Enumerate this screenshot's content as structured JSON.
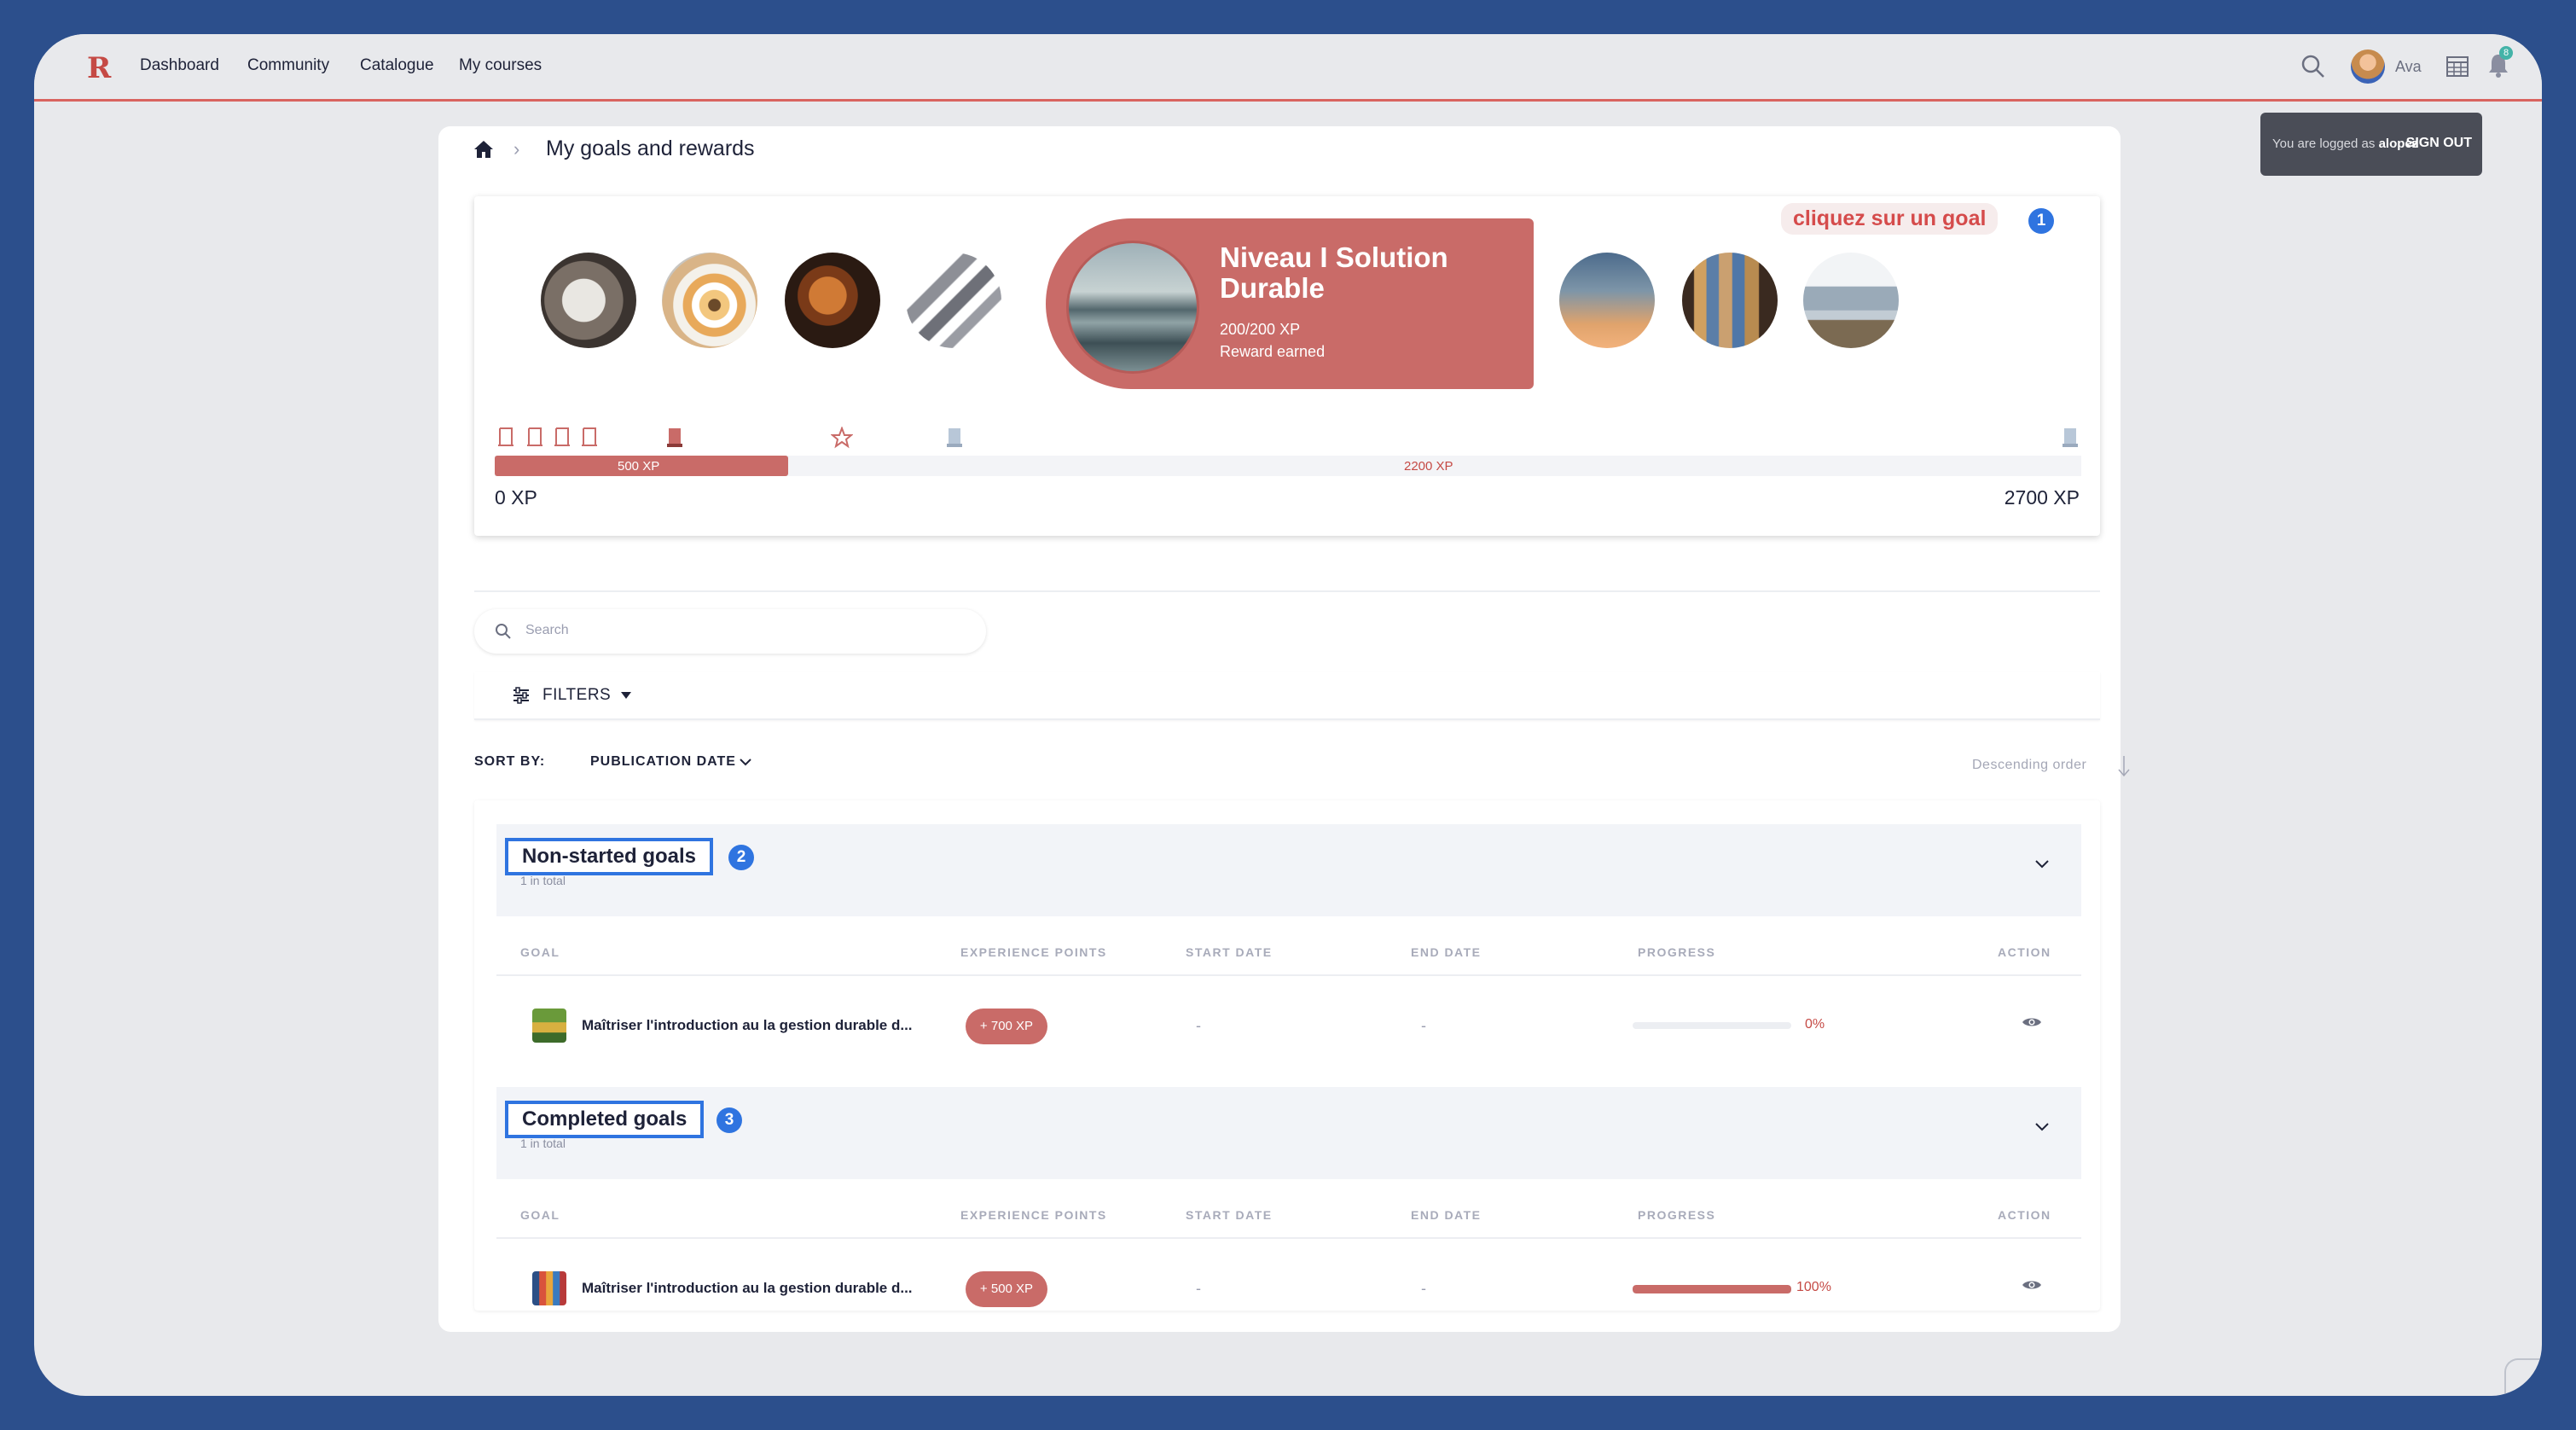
{
  "nav": {
    "logo": "R",
    "links": [
      "Dashboard",
      "Community",
      "Catalogue",
      "My courses"
    ],
    "user": "Ava",
    "notifications": "8"
  },
  "session": {
    "prefix": "You are logged as",
    "username": "alopez",
    "signout": "SIGN OUT"
  },
  "page": {
    "title": "My goals and rewards"
  },
  "rewards": {
    "hint": "cliquez sur un goal",
    "hint_num": "1",
    "featured": {
      "title": "Niveau I Solution Durable",
      "xp": "200/200 XP",
      "status": "Reward earned"
    },
    "bar": {
      "fill_label": "500 XP",
      "rest_label": "2200 XP",
      "start": "0 XP",
      "end": "2700 XP",
      "progress_percent": 18.5
    }
  },
  "search": {
    "placeholder": "Search"
  },
  "filters": {
    "label": "FILTERS"
  },
  "sort": {
    "label": "SORT BY:",
    "value": "PUBLICATION DATE",
    "order": "Descending order"
  },
  "columns": [
    "GOAL",
    "EXPERIENCE POINTS",
    "START DATE",
    "END DATE",
    "PROGRESS",
    "ACTION"
  ],
  "sections": [
    {
      "title": "Non-started goals",
      "num": "2",
      "subtitle": "1 in total",
      "row": {
        "name": "Maîtriser l'introduction au la gestion durable d...",
        "xp": "+ 700 XP",
        "start": "-",
        "end": "-",
        "progress_percent": 0,
        "progress_label": "0%"
      }
    },
    {
      "title": "Completed goals",
      "num": "3",
      "subtitle": "1 in total",
      "row": {
        "name": "Maîtriser l'introduction au la gestion durable d...",
        "xp": "+ 500 XP",
        "start": "-",
        "end": "-",
        "progress_percent": 100,
        "progress_label": "100%"
      }
    }
  ],
  "colors": {
    "accent": "#c96b68",
    "highlight": "#2f74e0",
    "nav_border": "#d9645f"
  }
}
